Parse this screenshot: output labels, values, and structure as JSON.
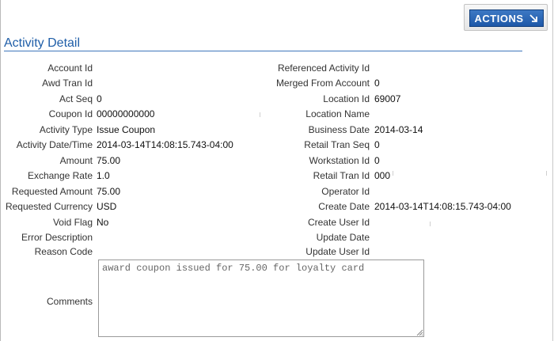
{
  "toolbar": {
    "actions_label": "ACTIONS"
  },
  "section": {
    "title": "Activity Detail"
  },
  "left_fields": [
    {
      "label": "Account Id",
      "value": ""
    },
    {
      "label": "Awd Tran Id",
      "value": ""
    },
    {
      "label": "Act Seq",
      "value": "0"
    },
    {
      "label": "Coupon Id",
      "value": "00000000000"
    },
    {
      "label": "Activity Type",
      "value": "Issue Coupon"
    },
    {
      "label": "Activity Date/Time",
      "value": "2014-03-14T14:08:15.743-04:00"
    },
    {
      "label": "Amount",
      "value": "75.00"
    },
    {
      "label": "Exchange Rate",
      "value": "1.0"
    },
    {
      "label": "Requested Amount",
      "value": "75.00"
    },
    {
      "label": "Requested Currency",
      "value": "USD"
    },
    {
      "label": "Void Flag",
      "value": "No"
    },
    {
      "label": "Error Description",
      "value": ""
    },
    {
      "label": "Reason Code",
      "value": ""
    }
  ],
  "right_fields": [
    {
      "label": "Referenced Activity Id",
      "value": ""
    },
    {
      "label": "Merged From Account",
      "value": "0"
    },
    {
      "label": "Location Id",
      "value": "69007"
    },
    {
      "label": "Location Name",
      "value": ""
    },
    {
      "label": "Business Date",
      "value": "2014-03-14"
    },
    {
      "label": "Retail Tran Seq",
      "value": "0"
    },
    {
      "label": "Workstation Id",
      "value": "0"
    },
    {
      "label": "Retail Tran Id",
      "value": "000"
    },
    {
      "label": "Operator Id",
      "value": ""
    },
    {
      "label": "Create Date",
      "value": "2014-03-14T14:08:15.743-04:00"
    },
    {
      "label": "Create User Id",
      "value": ""
    },
    {
      "label": "Update Date",
      "value": ""
    },
    {
      "label": "Update User Id",
      "value": ""
    }
  ],
  "comments": {
    "label": "Comments",
    "value": "award coupon issued for 75.00 for loyalty card"
  }
}
